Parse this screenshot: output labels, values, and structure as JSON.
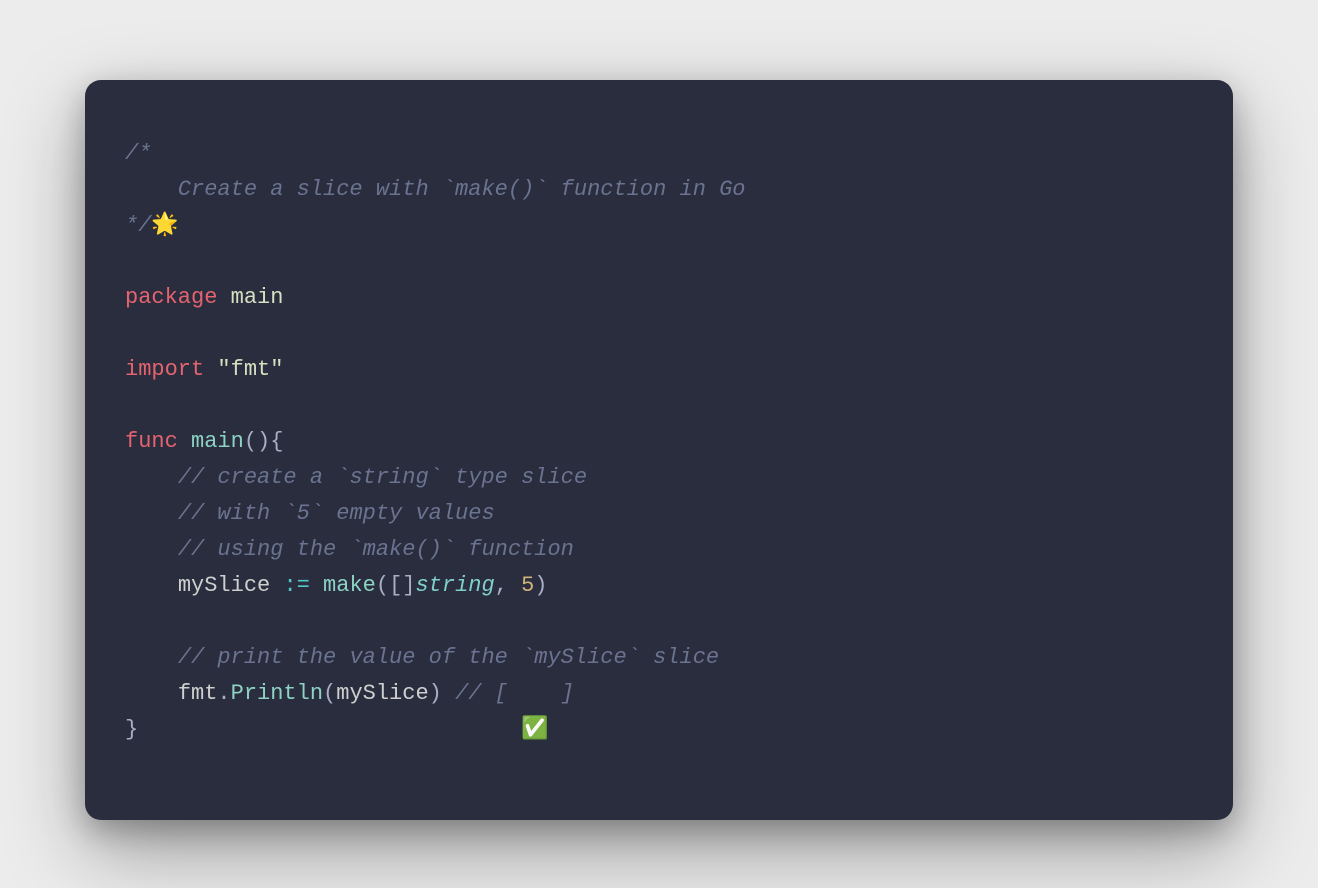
{
  "code": {
    "block_comment_open": "/*",
    "block_comment_line": "    Create a slice with `make()` function in Go",
    "block_comment_close": "*/",
    "emoji_sparkle": "🌟",
    "kw_package": "package",
    "pkg_name": "main",
    "kw_import": "import",
    "import_value": "\"fmt\"",
    "kw_func": "func",
    "func_name": "main",
    "func_sig_open": "(",
    "func_sig_close": ")",
    "brace_open": "{",
    "cmt1": "// create a `string` type slice",
    "cmt2": "// with `5` empty values",
    "cmt3": "// using the `make()` function",
    "var_name": "mySlice",
    "op_assign": ":=",
    "call_make": "make",
    "paren_open": "(",
    "bracket_pair": "[]",
    "type_string": "string",
    "comma": ",",
    "num_five": "5",
    "paren_close": ")",
    "cmt4": "// print the value of the `mySlice` slice",
    "pkg_fmt": "fmt",
    "dot": ".",
    "call_println": "Println",
    "arg_var": "mySlice",
    "trailing_cmt": "// [    ]",
    "brace_close": "}",
    "emoji_check": "✅"
  }
}
